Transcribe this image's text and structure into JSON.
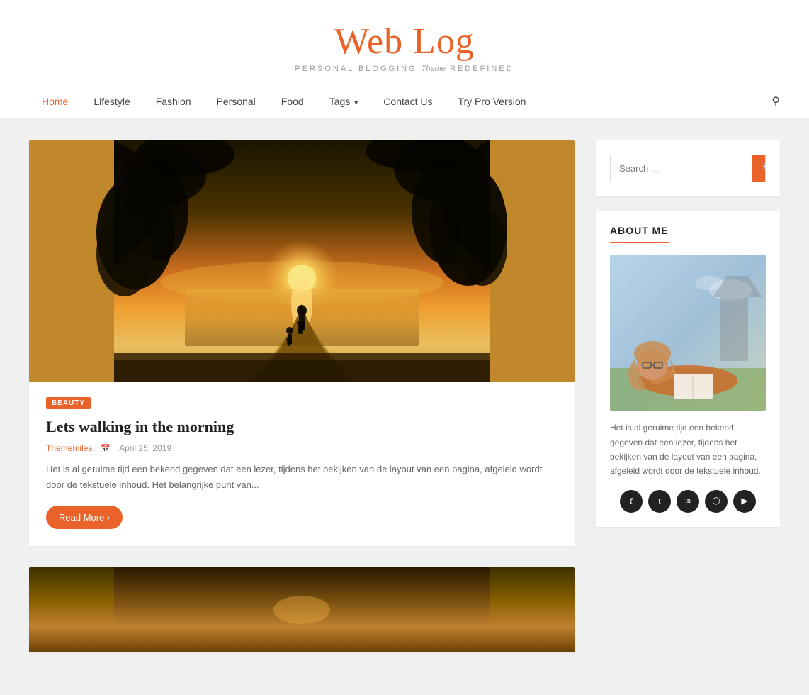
{
  "site": {
    "title": "Web Log",
    "tagline_part1": "PERSONAL BLOGGING ",
    "tagline_theme": "Theme",
    "tagline_part2": " REDEFINED"
  },
  "nav": {
    "items": [
      {
        "label": "Home",
        "active": true
      },
      {
        "label": "Lifestyle",
        "active": false
      },
      {
        "label": "Fashion",
        "active": false
      },
      {
        "label": "Personal",
        "active": false
      },
      {
        "label": "Food",
        "active": false
      },
      {
        "label": "Tags",
        "active": false,
        "has_dropdown": true
      },
      {
        "label": "Contact Us",
        "active": false
      },
      {
        "label": "Try Pro Version",
        "active": false
      }
    ]
  },
  "posts": [
    {
      "category": "BEAUTY",
      "title": "Lets walking in the morning",
      "author": "Thememiles",
      "date": "April 25, 2019",
      "excerpt": "Het is al geruime tijd een bekend gegeven dat een lezer, tijdens het bekijken van de layout van een pagina, afgeleid wordt door de tekstuele inhoud. Het belangrijke punt van...",
      "read_more": "Read More"
    }
  ],
  "sidebar": {
    "search": {
      "placeholder": "Search ...",
      "button_label": "Search"
    },
    "about": {
      "title": "ABOUT ME",
      "text": "Het is al geruime tijd een bekend gegeven dat een lezer, tijdens het bekijken van de layout van een pagina, afgeleid wordt door de tekstuele inhoud."
    },
    "social": [
      {
        "name": "facebook",
        "icon": "f"
      },
      {
        "name": "twitter",
        "icon": "t"
      },
      {
        "name": "linkedin",
        "icon": "in"
      },
      {
        "name": "instagram",
        "icon": "ig"
      },
      {
        "name": "youtube",
        "icon": "yt"
      }
    ]
  }
}
